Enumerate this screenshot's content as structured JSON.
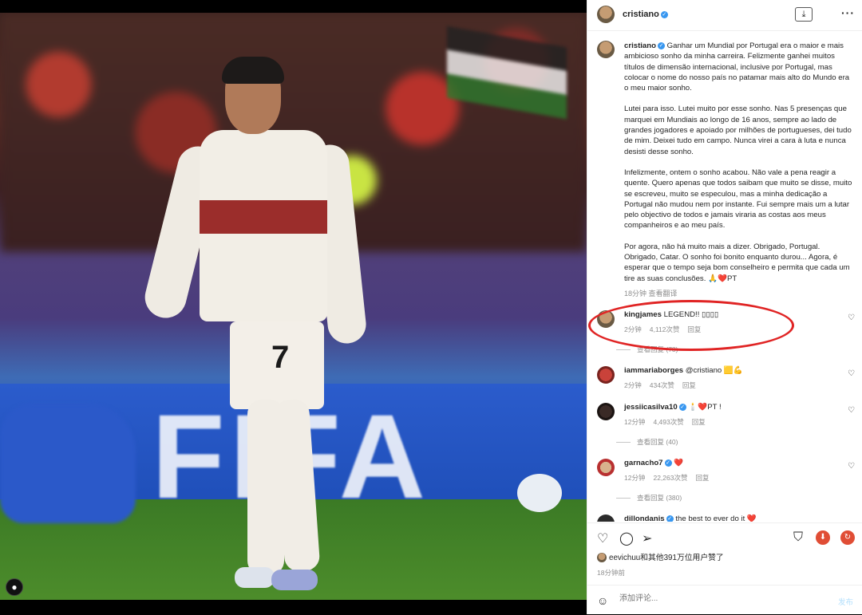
{
  "post": {
    "username": "cristiano",
    "caption_paragraphs": [
      "Ganhar um Mundial por Portugal era o maior e mais ambicioso sonho da minha carreira. Felizmente ganhei muitos títulos de dimensão internacional, inclusive por Portugal, mas colocar o nome do nosso país no patamar mais alto do Mundo era o meu maior sonho.",
      "Lutei para isso. Lutei muito por esse sonho. Nas 5 presenças que marquei em Mundiais ao longo de 16 anos, sempre ao lado de grandes jogadores e apoiado por milhões de portugueses, dei tudo de mim. Deixei tudo em campo. Nunca virei a cara à luta e nunca desisti desse sonho.",
      "Infelizmente, ontem o sonho acabou. Não vale a pena reagir a quente. Quero apenas que todos saibam que muito se disse, muito se escreveu, muito se especulou, mas a minha dedicação a Portugal não mudou nem por instante. Fui sempre mais um a lutar pelo objectivo de todos e jamais viraria as costas aos meus companheiros e ao meu país.",
      "Por agora, não há muito mais a dizer. Obrigado, Portugal. Obrigado, Catar. O sonho foi bonito enquanto durou... Agora, é esperar que o tempo seja bom conselheiro e permita que cada um tire as suas conclusões. 🙏❤️PT"
    ],
    "caption_meta": "18分钟  查看翻译",
    "photo_tag_icon": "person-icon",
    "photo_board_text": "FIFA"
  },
  "comments": [
    {
      "user": "kingjames",
      "verified": false,
      "text": "LEGEND!! ▯▯▯▯",
      "time": "2分钟",
      "likes": "4,112次赞",
      "reply": "回复",
      "replies": "查看回复 (78)"
    },
    {
      "user": "iammariaborges",
      "verified": false,
      "text": "@cristiano 🟨💪",
      "time": "2分钟",
      "likes": "434次赞",
      "reply": "回复",
      "replies": ""
    },
    {
      "user": "jessiicasilva10",
      "verified": true,
      "text": "🕯️❤️PT !",
      "time": "12分钟",
      "likes": "4,493次赞",
      "reply": "回复",
      "replies": "查看回复 (40)"
    },
    {
      "user": "garnacho7",
      "verified": true,
      "text": "❤️",
      "time": "12分钟",
      "likes": "22,263次赞",
      "reply": "回复",
      "replies": "查看回复 (380)"
    },
    {
      "user": "dillondanis",
      "verified": true,
      "text": "the best to ever do it ❤️",
      "time": "",
      "likes": "",
      "reply": "",
      "replies": ""
    }
  ],
  "likes_summary": "eevichuu和其他391万位用户赞了",
  "time_ago": "18分钟前",
  "comment_placeholder": "添加评论...",
  "post_button": "发布",
  "icons": {
    "download": "download-icon",
    "more": "more-icon",
    "heart": "heart-icon",
    "comment": "comment-icon",
    "share": "share-icon",
    "bookmark": "bookmark-icon",
    "emoji": "emoji-icon"
  },
  "colors": {
    "highlight": "#e02424",
    "verified": "#3897f0",
    "muted": "#8e8e8e"
  }
}
